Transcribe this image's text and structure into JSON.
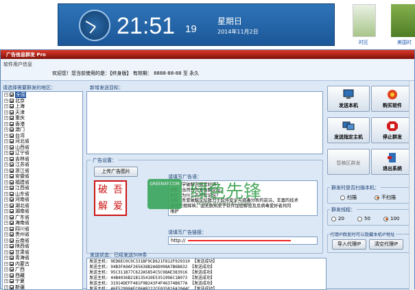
{
  "desktop": {
    "clock": {
      "time": "21:51",
      "seconds": "19",
      "weekday": "星期日",
      "date": "2014年11月2日"
    },
    "weather_labels": [
      "时区",
      "美国时"
    ]
  },
  "window": {
    "title": "广告信息群发 Pro",
    "info_label": "软件用户信息",
    "welcome": "欢迎您！您当前使用的是：【终身版】 有效期： 8888-88-88 至 永久"
  },
  "regions": {
    "label": "请选择需要群发的地区：",
    "items": [
      {
        "name": "全国",
        "selected": true
      },
      {
        "name": "北京"
      },
      {
        "name": "上海"
      },
      {
        "name": "天津"
      },
      {
        "name": "重庆"
      },
      {
        "name": "香港"
      },
      {
        "name": "澳门"
      },
      {
        "name": "台湾"
      },
      {
        "name": "河北省"
      },
      {
        "name": "山西省"
      },
      {
        "name": "辽宁省"
      },
      {
        "name": "吉林省"
      },
      {
        "name": "江苏省"
      },
      {
        "name": "浙江省"
      },
      {
        "name": "安徽省"
      },
      {
        "name": "福建省"
      },
      {
        "name": "江西省"
      },
      {
        "name": "山东省"
      },
      {
        "name": "河南省"
      },
      {
        "name": "湖北省"
      },
      {
        "name": "湖南省"
      },
      {
        "name": "广东省"
      },
      {
        "name": "海南省"
      },
      {
        "name": "四川省"
      },
      {
        "name": "贵州省"
      },
      {
        "name": "云南省"
      },
      {
        "name": "陕西省"
      },
      {
        "name": "甘肃省"
      },
      {
        "name": "青海省"
      },
      {
        "name": "内蒙古"
      },
      {
        "name": "广西"
      },
      {
        "name": "西藏"
      },
      {
        "name": "宁夏"
      },
      {
        "name": "新疆"
      }
    ]
  },
  "targets": {
    "label": "新增发送目标："
  },
  "ad": {
    "settings_label": "广告设置：",
    "upload_button": "上传广告图片",
    "stamp_chars": [
      "破",
      "吾",
      "解",
      "爱"
    ],
    "text_label": "请填写广告语：",
    "text_lines": [
      "A问：学破解去哪里好呀？",
      "B答：当然去吾爱破解论坛。",
      "A问：为什么去吾爱论坛？",
      "B答：吾爱破解论坛致力于软件安全与病毒分析的前沿，丰富的技术",
      "版块交相辉映，由无数热衷于软件加密解密及反病毒爱好者共同",
      "维护"
    ],
    "link_label": "请填写广告链接：",
    "link_value": "http://"
  },
  "status": {
    "label": "发送状态：已经发送508条",
    "log": [
      "发送主机: 9ED6EC0C9C331BF9CD621F812F929310 【发送成功】",
      "发送主机: 94B3FA9AF265638B2A6D098A7B6B832 【发送成功】",
      "发送主机: 95C311B77C622A5854C5C98AE383916 【发送成功】",
      "发送主机: 44B4036B21B135410E5351996C1B073 【发送成功】",
      "发送主机: 31914DEFF481F9B243F4F46374B877A 【发送成功】",
      "发送主机: 46E52990AFC06AB222CE035816A2044C 【发送成功】"
    ]
  },
  "actions": {
    "send_local": "发送本机",
    "buy": "购买软件",
    "send_host": "发送指定主机",
    "stop": "停止群发",
    "pause": "暂稿区群发",
    "exit": "退出系统"
  },
  "scan": {
    "label": "群发时是否扫描本机：",
    "options": [
      "扫描",
      "不扫描"
    ],
    "selected": "不扫描"
  },
  "speed": {
    "label": "群发线程：",
    "options": [
      "20",
      "50",
      "100"
    ],
    "selected": "100"
  },
  "proxy": {
    "label": "代理IP群发时可以隐藏本机IP地址",
    "import_button": "导入代理IP",
    "clear_button": "清空代理IP"
  },
  "watermark": {
    "badge": "GREENXF.COM",
    "text": "绿色先锋",
    "url": "www.greenxf.com"
  },
  "colors": {
    "title_red": "#c0291d",
    "window_bg": "#dce8f5",
    "selected_blue": "#1d4f9c"
  }
}
